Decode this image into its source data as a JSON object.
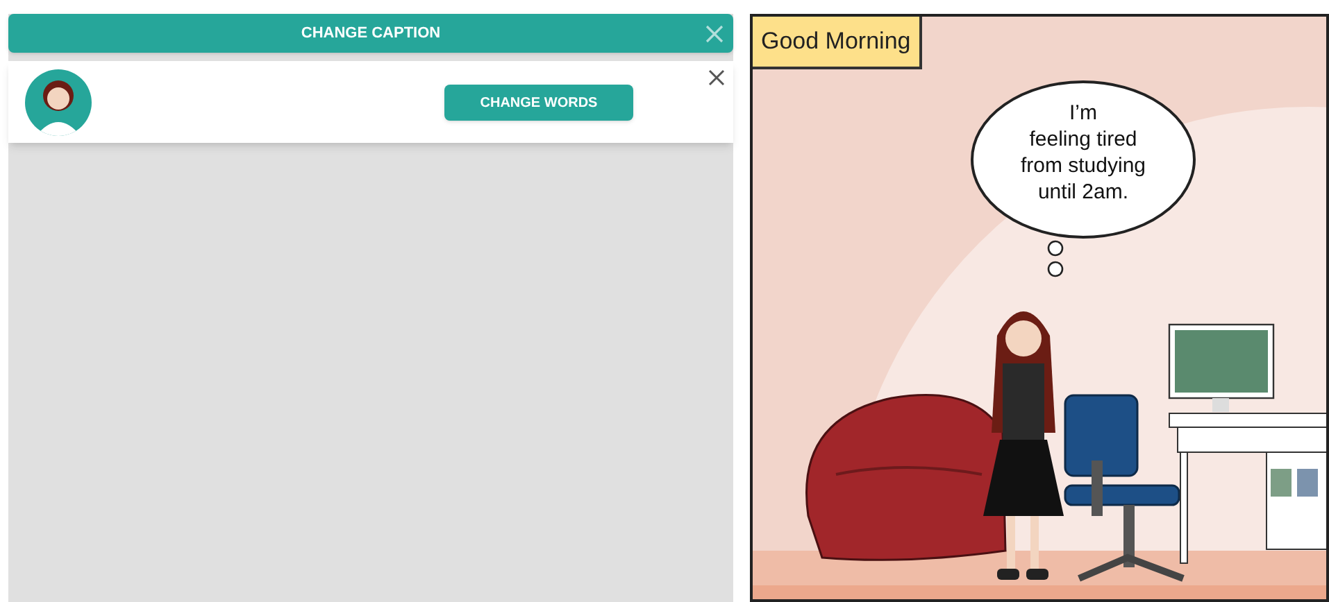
{
  "caption_bar": {
    "title": "CHANGE CAPTION"
  },
  "speaker_card": {
    "button": "CHANGE WORDS"
  },
  "comic_panel": {
    "caption": "Good Morning",
    "thought_bubble": "I’m\nfeeling tired\nfrom studying\nuntil 2am."
  }
}
